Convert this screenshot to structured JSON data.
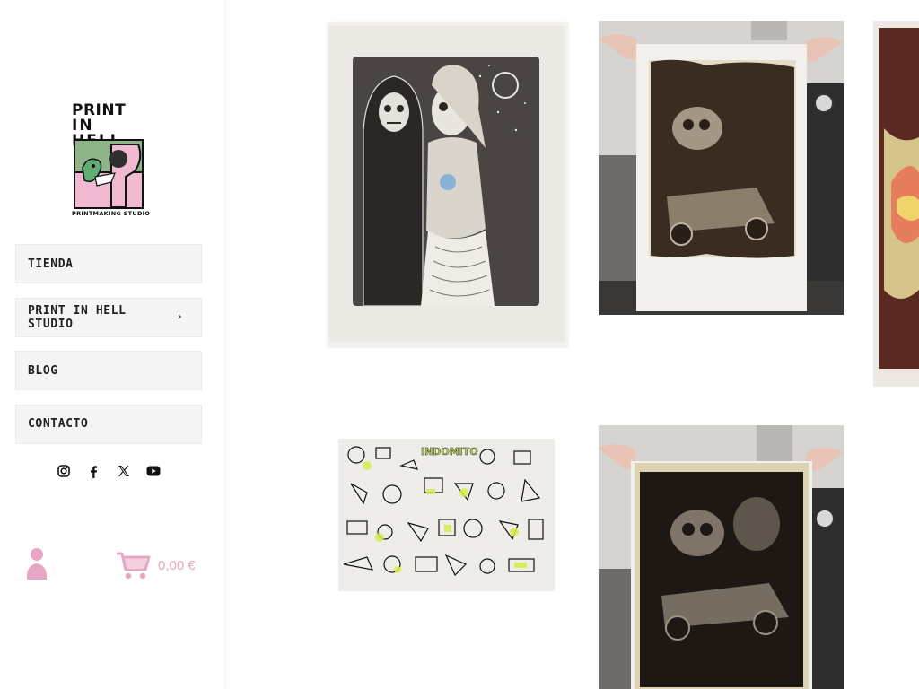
{
  "brand": {
    "logo_line1": "PRINT",
    "logo_line2": "IN HELL",
    "logo_sub": "PRINTMAKING STUDIO"
  },
  "nav": {
    "items": [
      {
        "label": "TIENDA",
        "has_submenu": false
      },
      {
        "label": "PRINT IN HELL STUDIO",
        "has_submenu": true,
        "submenu_icon": "chevron-right-icon"
      },
      {
        "label": "BLOG",
        "has_submenu": false
      },
      {
        "label": "CONTACTO",
        "has_submenu": false
      }
    ]
  },
  "social": [
    "instagram-icon",
    "facebook-icon",
    "x-icon",
    "youtube-icon"
  ],
  "cart": {
    "total": "0,00 €",
    "icon": "cart-icon"
  },
  "account": {
    "icon": "user-icon"
  },
  "colors": {
    "accent_pink": "#e7a6c3",
    "nav_bg": "#f5f5f5",
    "logo_green": "#8fb48a",
    "logo_pink": "#f0b8d1"
  },
  "gallery": {
    "items": [
      {
        "name": "artwork-skeletons-print"
      },
      {
        "name": "artwork-skull-car-print-held"
      },
      {
        "name": "artwork-partial-right"
      },
      {
        "name": "artwork-indomito-sheet"
      },
      {
        "name": "artwork-skull-car-dark-print-held"
      }
    ]
  }
}
